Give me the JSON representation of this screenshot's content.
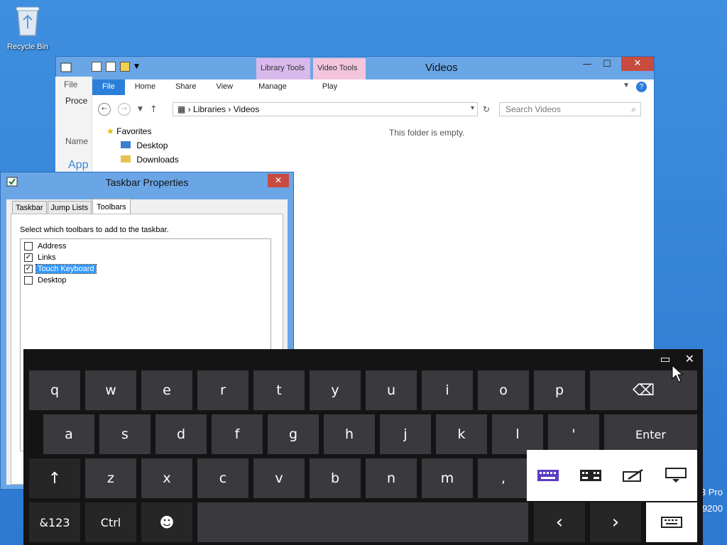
{
  "desktop": {
    "recycle_bin_label": "Recycle Bin",
    "corner_line1": "3 Pro",
    "corner_line2": "9200"
  },
  "explorer": {
    "title": "Videos",
    "context_tabs": {
      "library_tools": "Library Tools",
      "video_tools": "Video Tools"
    },
    "ribbon_tabs": [
      "File",
      "Home",
      "Share",
      "View",
      "Manage",
      "Play"
    ],
    "address": {
      "root": "Libraries",
      "current": "Videos"
    },
    "search_placeholder": "Search Videos",
    "nav": {
      "favorites": "Favorites",
      "items": [
        "Desktop",
        "Downloads"
      ]
    },
    "empty_message": "This folder is empty.",
    "controls": {
      "minimize": "—",
      "maximize": "☐",
      "close": "✕"
    }
  },
  "background_window": {
    "file_label": "File",
    "proc_label": "Proce",
    "name_label": "Name",
    "app_label": "App"
  },
  "taskbar_properties": {
    "title": "Taskbar Properties",
    "close": "✕",
    "tabs": [
      "Taskbar",
      "Jump Lists",
      "Toolbars"
    ],
    "active_tab": "Toolbars",
    "description": "Select which toolbars to add to the taskbar.",
    "toolbars": [
      {
        "label": "Address",
        "checked": false,
        "selected": false
      },
      {
        "label": "Links",
        "checked": true,
        "selected": false
      },
      {
        "label": "Touch Keyboard",
        "checked": true,
        "selected": true
      },
      {
        "label": "Desktop",
        "checked": false,
        "selected": false
      }
    ]
  },
  "keyboard": {
    "row1": [
      "q",
      "w",
      "e",
      "r",
      "t",
      "y",
      "u",
      "i",
      "o",
      "p"
    ],
    "row2": [
      "a",
      "s",
      "d",
      "f",
      "g",
      "h",
      "j",
      "k",
      "l",
      "'"
    ],
    "row3": [
      "z",
      "x",
      "c",
      "v",
      "b",
      "n",
      "m",
      ","
    ],
    "enter": "Enter",
    "sym_key": "&123",
    "ctrl_key": "Ctrl",
    "backspace_glyph": "⌫",
    "shift_glyph": "↑",
    "emoji_glyph": "☻",
    "left_glyph": "‹",
    "right_glyph": "›",
    "top_controls": {
      "dock": "▭",
      "close": "✕"
    },
    "layout_icons": [
      "standard-keyboard-icon",
      "split-keyboard-icon",
      "handwriting-icon",
      "hide-keyboard-icon"
    ],
    "accent_color": "#5b3cc4"
  }
}
